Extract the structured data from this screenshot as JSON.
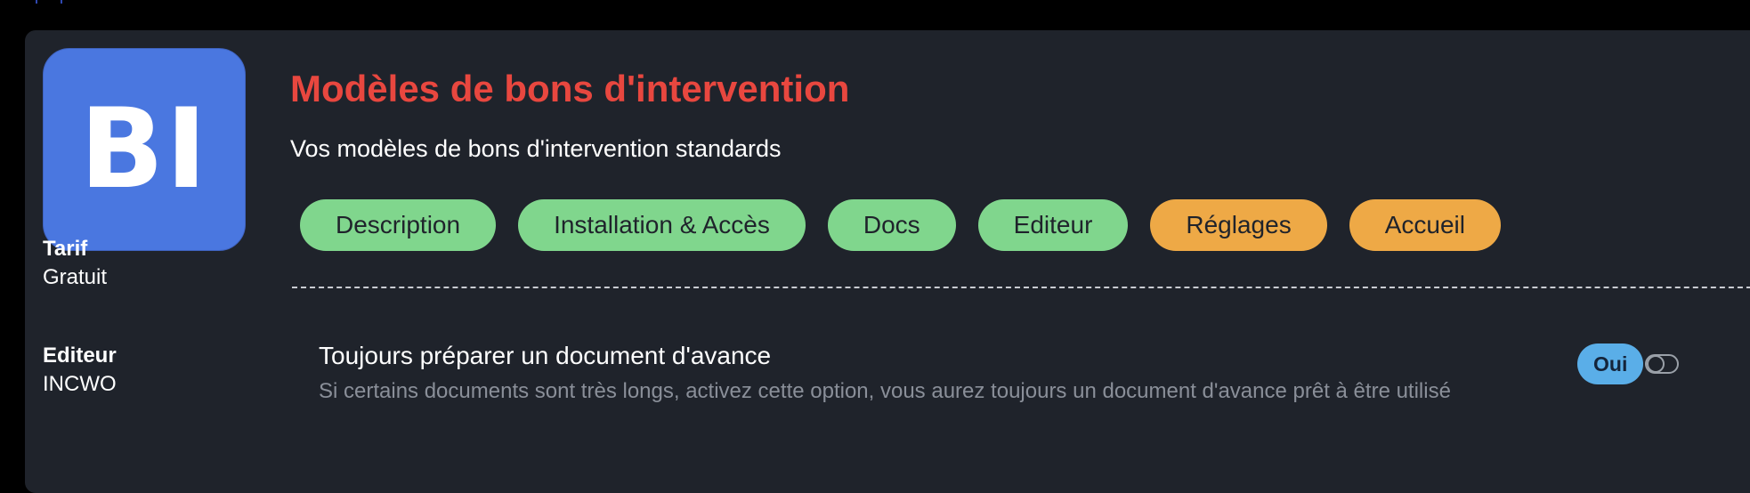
{
  "app": {
    "logo_text": "BI",
    "title": "Modèles de bons d'intervention",
    "subtitle": "Vos modèles de bons d'intervention standards"
  },
  "sidebar": {
    "tarif_label": "Tarif",
    "tarif_value": "Gratuit",
    "editeur_label": "Editeur",
    "editeur_value": "INCWO"
  },
  "tabs": [
    {
      "label": "Description",
      "color": "#80d68d"
    },
    {
      "label": "Installation & Accès",
      "color": "#80d68d"
    },
    {
      "label": "Docs",
      "color": "#80d68d"
    },
    {
      "label": "Editeur",
      "color": "#80d68d"
    },
    {
      "label": "Réglages",
      "color": "#eea946"
    },
    {
      "label": "Accueil",
      "color": "#eea946"
    }
  ],
  "settings": [
    {
      "title": "Toujours préparer un document d'avance",
      "description": "Si certains documents sont très longs, activez cette option, vous aurez toujours un document d'avance prêt à être utilisé",
      "state_label": "Oui",
      "enabled": true
    }
  ],
  "colors": {
    "title": "#e8473f",
    "logo_bg": "#4a77e0",
    "panel_bg": "#1f232b",
    "tab_green": "#80d68d",
    "tab_orange": "#eea946",
    "badge_blue": "#5aaee8"
  }
}
